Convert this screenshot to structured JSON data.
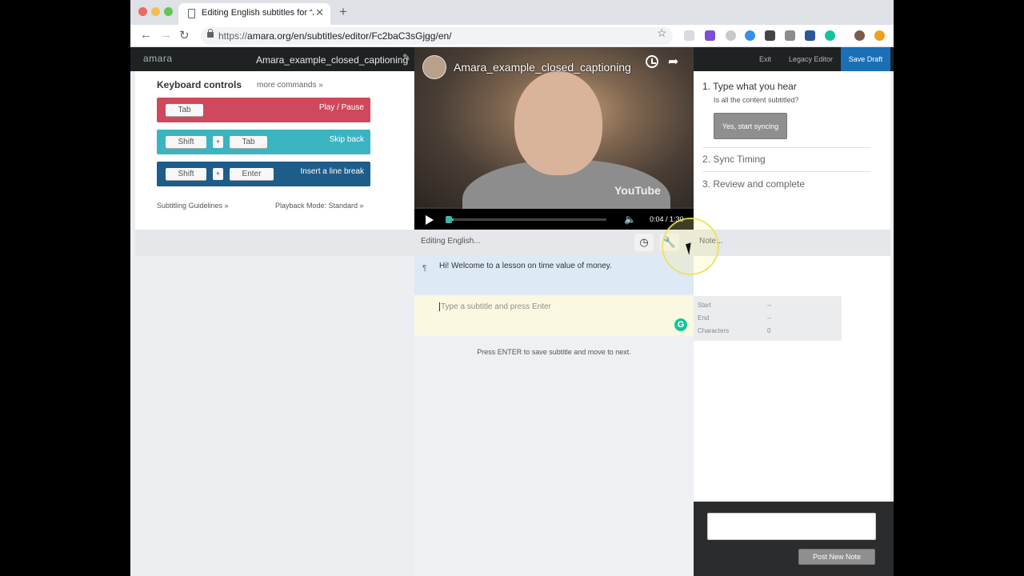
{
  "browser": {
    "tab_title": "Editing English subtitles for “A",
    "new_tab_symbol": "+",
    "close_symbol": "✕",
    "url_prefix": "https://",
    "url_main": "amara.org/en/subtitles/editor/Fc2baC3sGjgg/en/"
  },
  "header": {
    "logo": "amara",
    "video_name": "Amara_example_closed_captioning",
    "exit": "Exit",
    "legacy": "Legacy Editor",
    "save_draft": "Save Draft"
  },
  "keyboard": {
    "title": "Keyboard controls",
    "more": "more commands »",
    "rows": [
      {
        "keys": [
          "Tab"
        ],
        "action": "Play / Pause"
      },
      {
        "keys": [
          "Shift",
          "Tab"
        ],
        "action": "Skip back"
      },
      {
        "keys": [
          "Shift",
          "Enter"
        ],
        "action": "Insert a line break"
      }
    ],
    "plus": "+",
    "guidelines": "Subtitling Guidelines »",
    "playback_mode": "Playback Mode: Standard »"
  },
  "video": {
    "title": "Amara_example_closed_captioning",
    "brand": "YouTube",
    "time": "0:04 / 1:30",
    "progress_fraction": 0.044
  },
  "editor": {
    "editing_label": "Editing English...",
    "note_label": "Note...",
    "subtitles": [
      {
        "text": "Hi! Welcome to a lesson on time value of money."
      }
    ],
    "input_placeholder": "Type a subtitle and press Enter",
    "help": "Press ENTER to save subtitle and move to next."
  },
  "steps": {
    "step1": "1. Type what you hear",
    "question": "Is all the content subtitled?",
    "sync_button": "Yes, start syncing",
    "step2": "2. Sync Timing",
    "step3": "3. Review and complete"
  },
  "info": {
    "start_label": "Start",
    "start_value": "--",
    "end_label": "End",
    "end_value": "--",
    "chars_label": "Characters",
    "chars_value": "0"
  },
  "notes": {
    "post_button": "Post New Note"
  }
}
